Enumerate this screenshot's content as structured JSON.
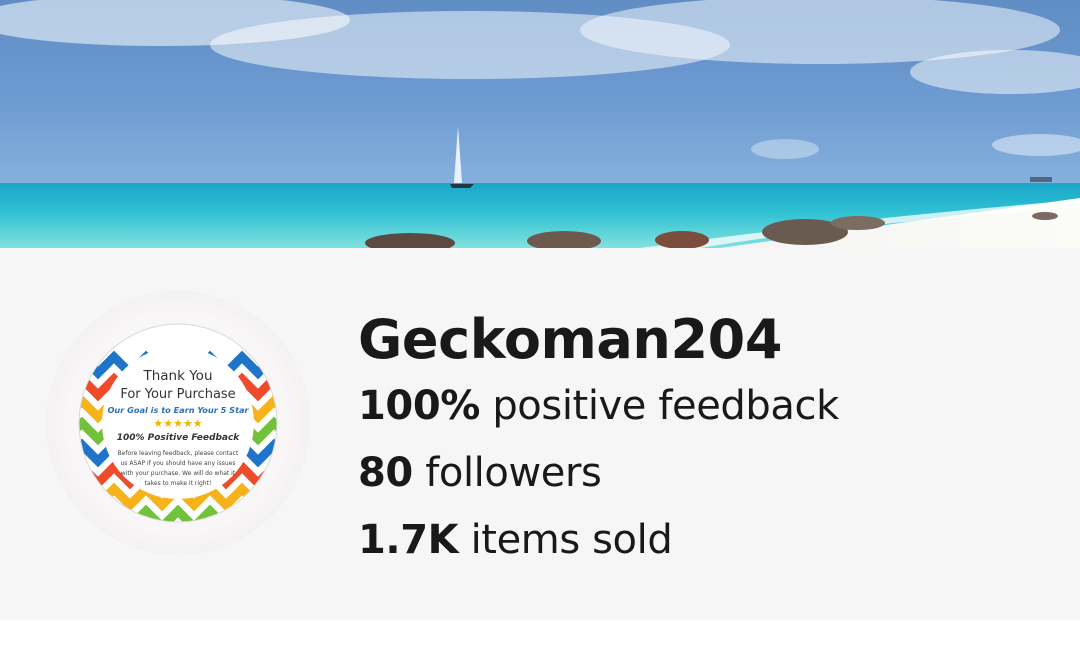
{
  "store": {
    "name": "Geckoman204",
    "feedback": {
      "value": "100%",
      "label": "positive feedback"
    },
    "followers": {
      "value": "80",
      "label": "followers"
    },
    "items_sold": {
      "value": "1.7K",
      "label": "items sold"
    }
  },
  "avatar": {
    "line1": "Thank You",
    "line2": "For Your Purchase",
    "line3": "Our Goal is to Earn Your 5 Star",
    "stars": "★★★★★",
    "line4": "100% Positive Feedback",
    "line5": "Before leaving feedback, please contact",
    "line6": "us ASAP if you should have any issues",
    "line7": "with your purchase. We will do what it",
    "line8": "takes to make it right!"
  }
}
